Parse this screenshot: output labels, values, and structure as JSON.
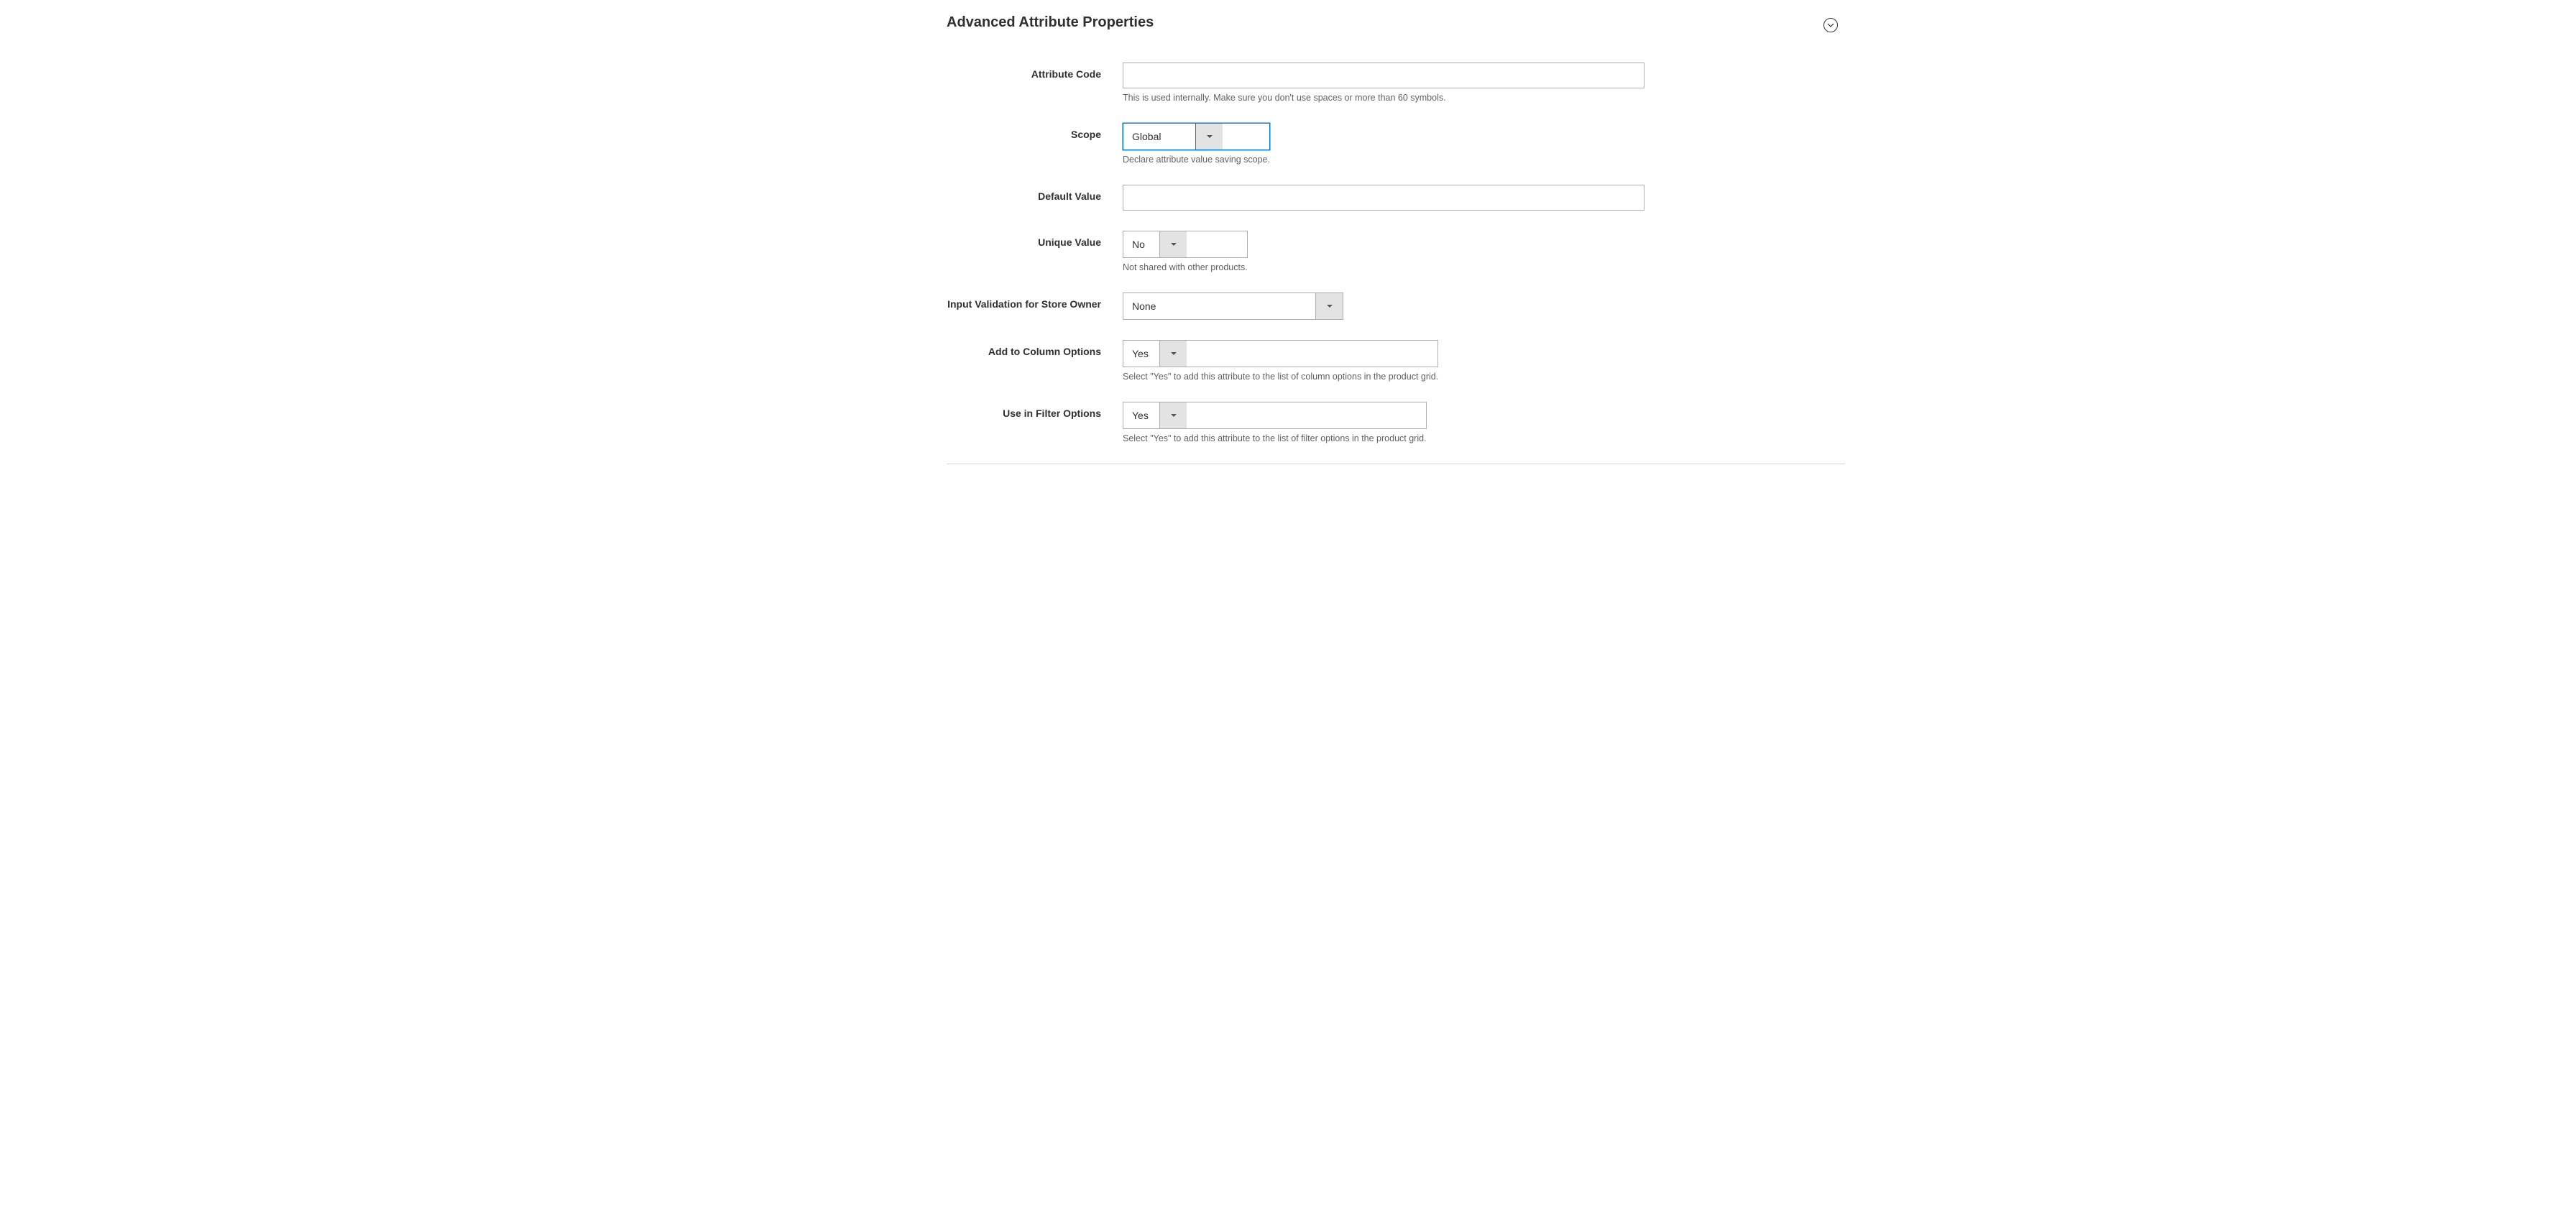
{
  "section": {
    "title": "Advanced Attribute Properties"
  },
  "fields": {
    "attribute_code": {
      "label": "Attribute Code",
      "value": "",
      "note": "This is used internally. Make sure you don't use spaces or more than 60 symbols."
    },
    "scope": {
      "label": "Scope",
      "value": "Global",
      "note": "Declare attribute value saving scope."
    },
    "default_value": {
      "label": "Default Value",
      "value": ""
    },
    "unique_value": {
      "label": "Unique Value",
      "value": "No",
      "note": "Not shared with other products."
    },
    "input_validation": {
      "label": "Input Validation for Store Owner",
      "value": "None"
    },
    "add_to_column": {
      "label": "Add to Column Options",
      "value": "Yes",
      "note": "Select \"Yes\" to add this attribute to the list of column options in the product grid."
    },
    "use_in_filter": {
      "label": "Use in Filter Options",
      "value": "Yes",
      "note": "Select \"Yes\" to add this attribute to the list of filter options in the product grid."
    }
  }
}
